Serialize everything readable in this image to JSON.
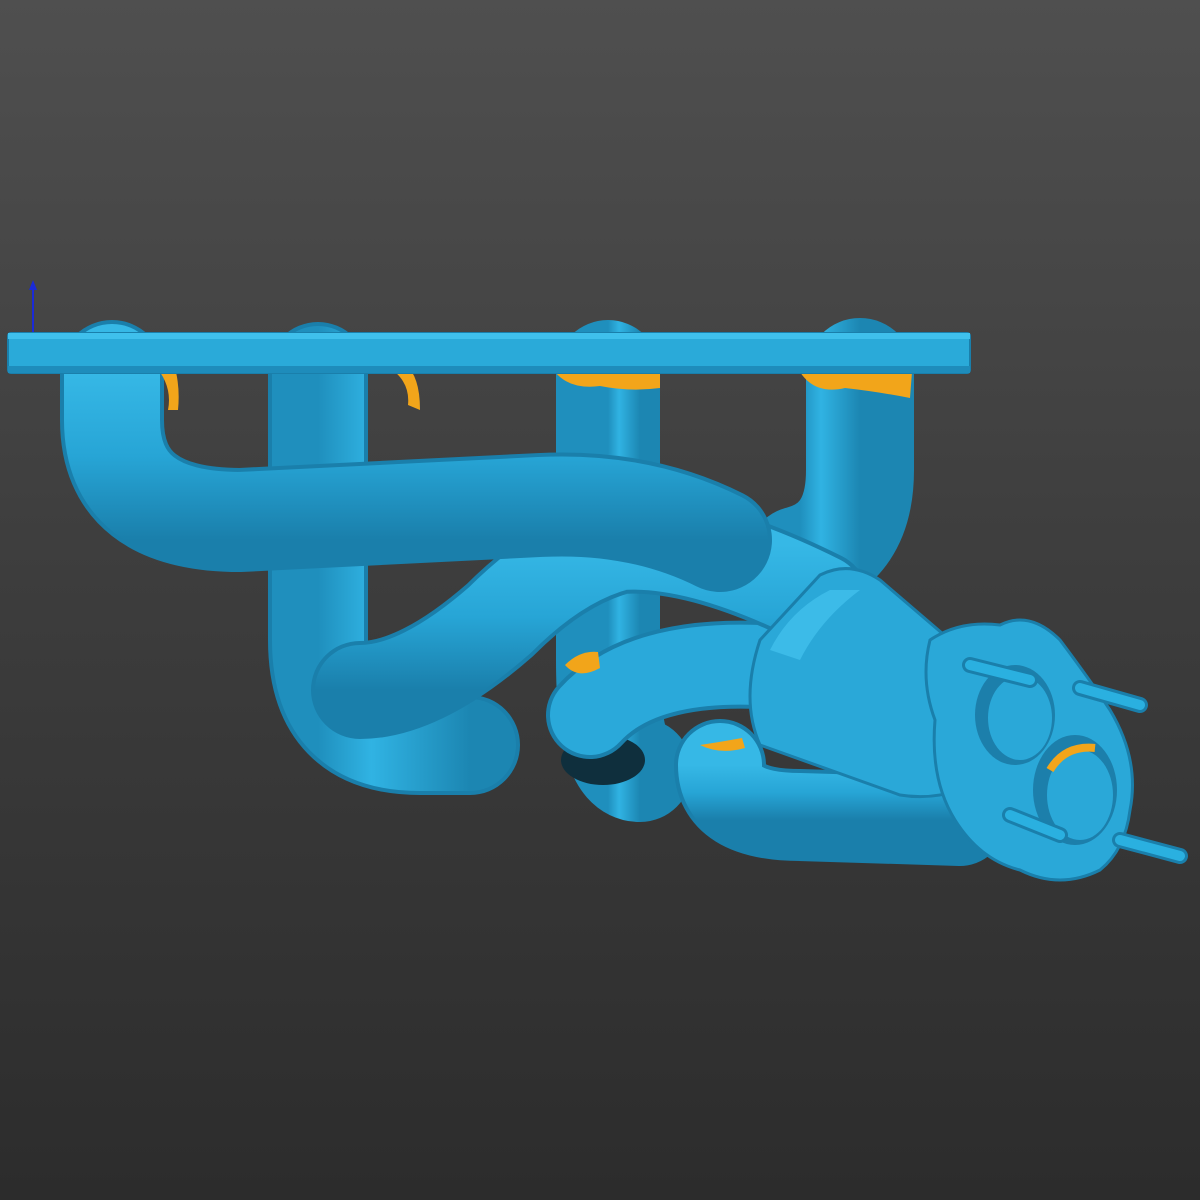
{
  "viewport": {
    "background_top": "#505050",
    "background_bottom": "#2a2a2a"
  },
  "model": {
    "object": "exhaust-manifold-scan",
    "surface_color": "#29a8d8",
    "highlight_color": "#f2a51a",
    "dark_color": "#0b5e80"
  },
  "axis_triad": {
    "x_color": "#d22a2a",
    "z_color": "#1a2ad8"
  }
}
